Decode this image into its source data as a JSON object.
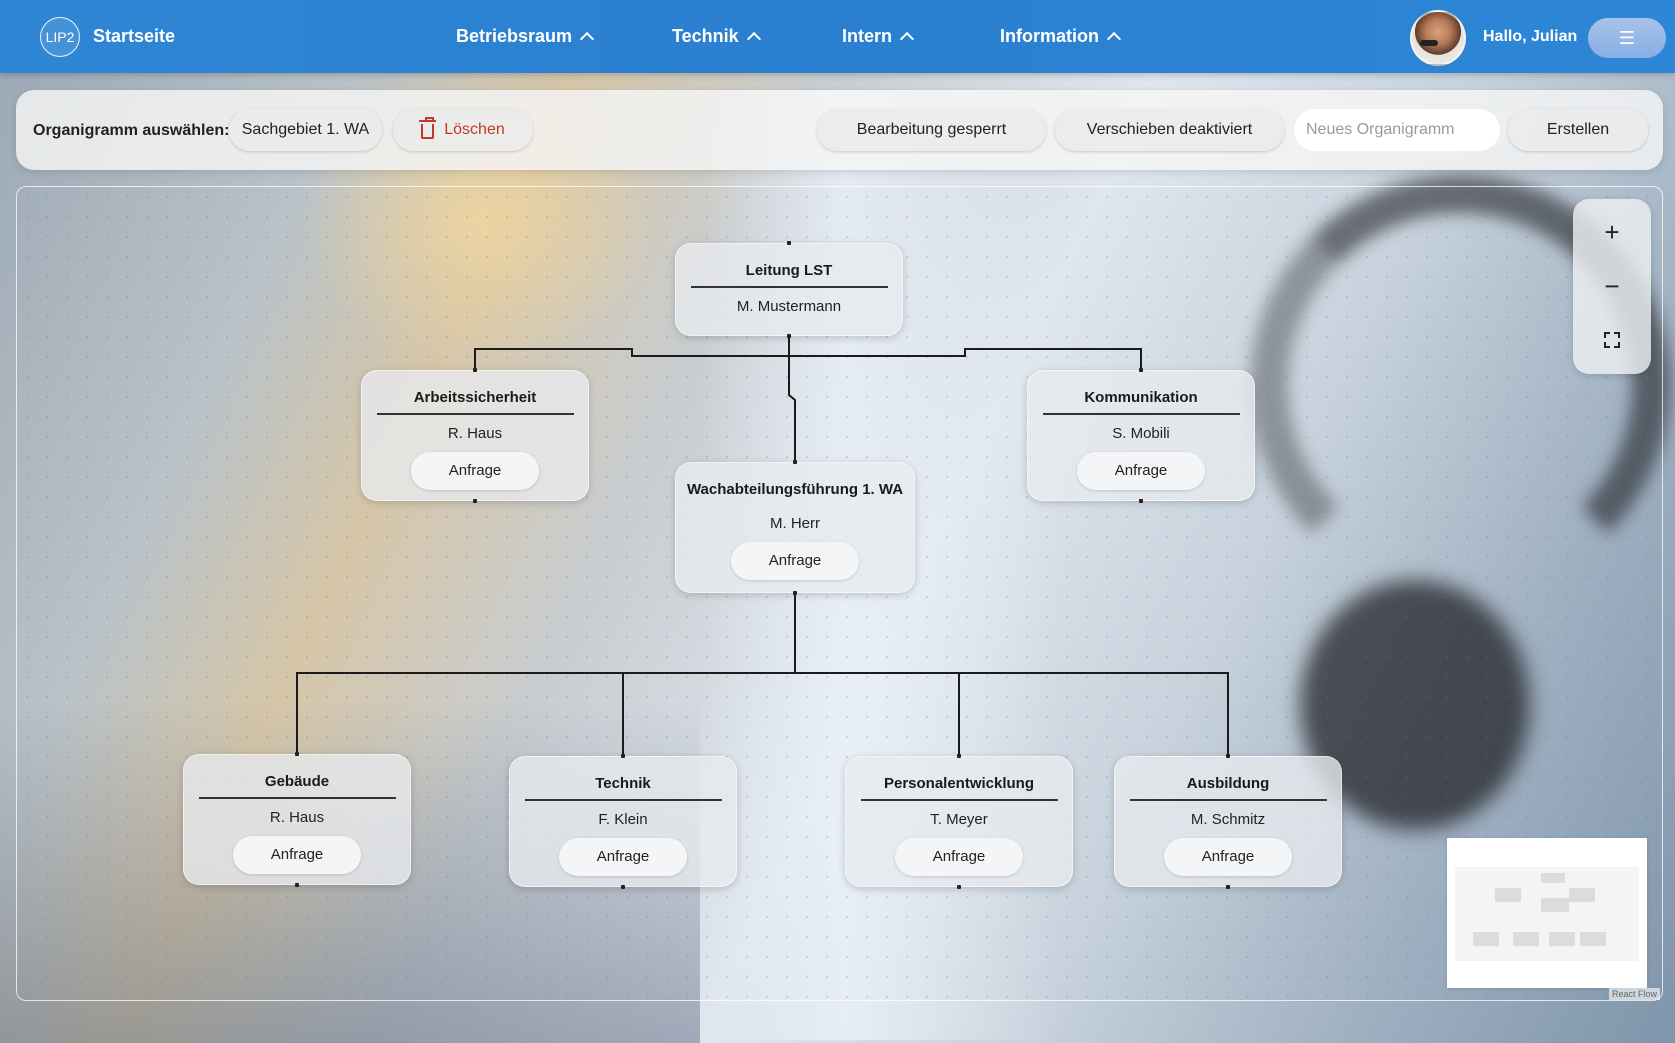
{
  "header": {
    "logo_text": "LIP2",
    "home_label": "Startseite",
    "nav": [
      {
        "label": "Betriebsraum"
      },
      {
        "label": "Technik"
      },
      {
        "label": "Intern"
      },
      {
        "label": "Information"
      }
    ],
    "greeting": "Hallo, Julian",
    "menu_icon": "☰"
  },
  "toolbar": {
    "select_label": "Organigramm auswählen:",
    "selected_chart": "Sachgebiet 1. WA",
    "delete_label": "Löschen",
    "edit_lock_label": "Bearbeitung gesperrt",
    "move_lock_label": "Verschieben deaktiviert",
    "new_chart_placeholder": "Neues Organigramm",
    "new_chart_value": "",
    "create_label": "Erstellen"
  },
  "org": {
    "root": {
      "title": "Leitung LST",
      "person": "M. Mustermann"
    },
    "arbeitssicherheit": {
      "title": "Arbeitssicherheit",
      "person": "R. Haus",
      "action": "Anfrage"
    },
    "kommunikation": {
      "title": "Kommunikation",
      "person": "S. Mobili",
      "action": "Anfrage"
    },
    "wachabteilung": {
      "title": "Wachabteilungsführung 1. WA",
      "person": "M. Herr",
      "action": "Anfrage"
    },
    "gebaeude": {
      "title": "Gebäude",
      "person": "R. Haus",
      "action": "Anfrage"
    },
    "technik": {
      "title": "Technik",
      "person": "F. Klein",
      "action": "Anfrage"
    },
    "personal": {
      "title": "Personalentwicklung",
      "person": "T. Meyer",
      "action": "Anfrage"
    },
    "ausbildung": {
      "title": "Ausbildung",
      "person": "M. Schmitz",
      "action": "Anfrage"
    }
  },
  "controls": {
    "zoom_in": "+",
    "zoom_out": "−"
  },
  "attribution": "React Flow"
}
